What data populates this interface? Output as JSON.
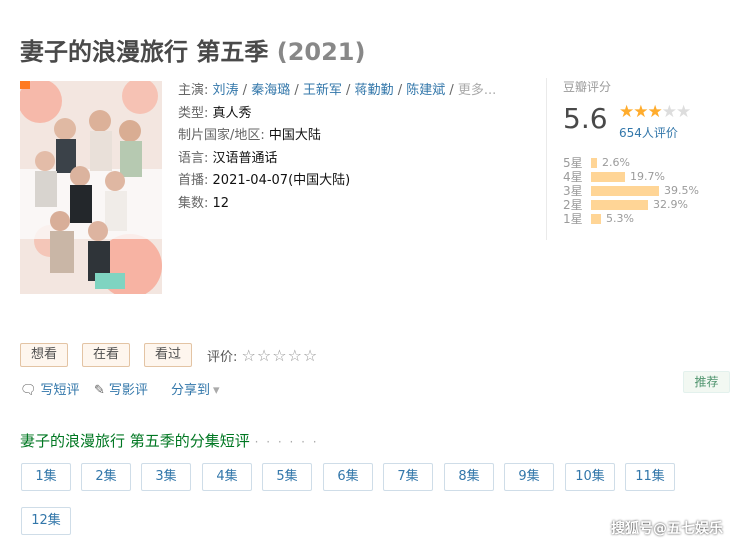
{
  "title": {
    "main": "妻子的浪漫旅行 第五季",
    "year": "(2021)"
  },
  "poster": {
    "alt": "poster"
  },
  "info": {
    "cast_label": "主演:",
    "cast": [
      "刘涛",
      "秦海璐",
      "王新军",
      "蒋勤勤",
      "陈建斌"
    ],
    "cast_more": "更多...",
    "type_label": "类型:",
    "type": "真人秀",
    "region_label": "制片国家/地区:",
    "region": "中国大陆",
    "lang_label": "语言:",
    "lang": "汉语普通话",
    "premiere_label": "首播:",
    "premiere": "2021-04-07(中国大陆)",
    "episodes_label": "集数:",
    "episodes": "12"
  },
  "rating": {
    "header": "豆瓣评分",
    "score": "5.6",
    "stars": 3,
    "votes": "654人评价",
    "distribution": [
      {
        "label": "5星",
        "pct": "2.6%",
        "value": 2.6
      },
      {
        "label": "4星",
        "pct": "19.7%",
        "value": 19.7
      },
      {
        "label": "3星",
        "pct": "39.5%",
        "value": 39.5
      },
      {
        "label": "2星",
        "pct": "32.9%",
        "value": 32.9
      },
      {
        "label": "1星",
        "pct": "5.3%",
        "value": 5.3
      }
    ]
  },
  "buttons": {
    "want": "想看",
    "watching": "在看",
    "watched": "看过"
  },
  "eval_label": "评价:",
  "actions": {
    "short_review": "写短评",
    "long_review": "写影评",
    "share": "分享到"
  },
  "recommend": "推荐",
  "episode_section": {
    "title": "妻子的浪漫旅行 第五季的分集短评",
    "dots": "· · · · · ·"
  },
  "episodes": [
    "1集",
    "2集",
    "3集",
    "4集",
    "5集",
    "6集",
    "7集",
    "8集",
    "9集",
    "10集",
    "11集",
    "12集"
  ],
  "watermark": "搜狐号@五七娱乐"
}
